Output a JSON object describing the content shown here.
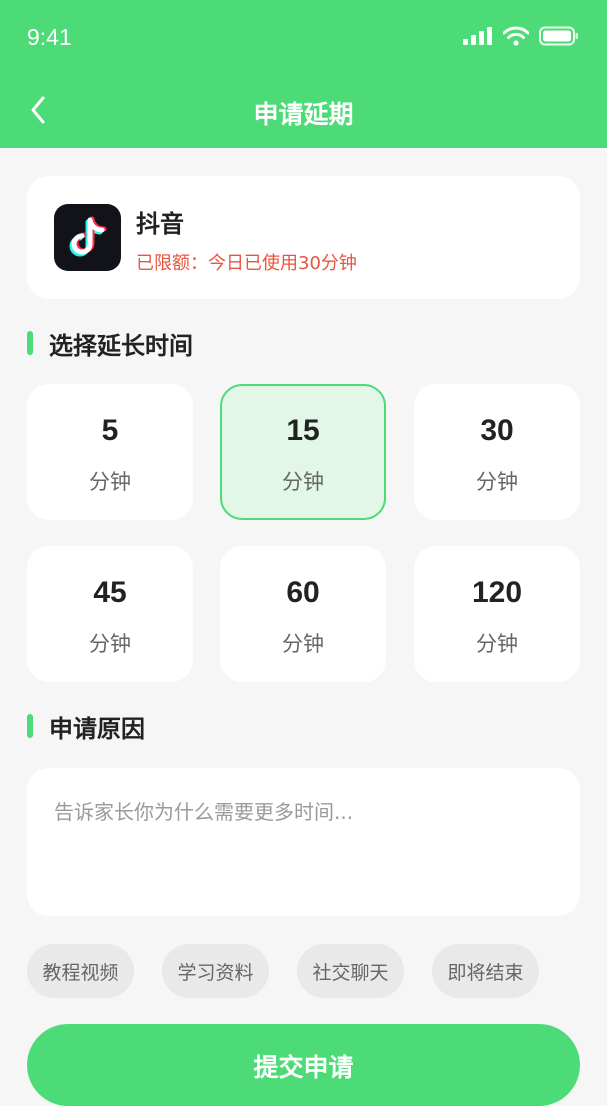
{
  "status_bar": {
    "time": "9:41"
  },
  "nav": {
    "title": "申请延期"
  },
  "app": {
    "name": "抖音",
    "status_text": "已限额：今日已使用30分钟"
  },
  "extend_section": {
    "title": "选择延长时间"
  },
  "options": [
    {
      "value": "5",
      "unit": "分钟",
      "selected": false
    },
    {
      "value": "15",
      "unit": "分钟",
      "selected": true
    },
    {
      "value": "30",
      "unit": "分钟",
      "selected": false
    },
    {
      "value": "45",
      "unit": "分钟",
      "selected": false
    },
    {
      "value": "60",
      "unit": "分钟",
      "selected": false
    },
    {
      "value": "120",
      "unit": "分钟",
      "selected": false
    }
  ],
  "reason_section": {
    "title": "申请原因"
  },
  "reason": {
    "placeholder": "告诉家长你为什么需要更多时间...",
    "value": ""
  },
  "quick_reasons": [
    "教程视频",
    "学习资料",
    "社交聊天",
    "即将结束"
  ],
  "submit": {
    "label": "提交申请"
  },
  "colors": {
    "brand_green": "#4cdb77",
    "selected_bg": "#e2f7e7",
    "warning_red": "#e8553e",
    "page_bg": "#f6f6f6"
  },
  "icons": {
    "back": "chevron-left-icon",
    "signal": "cellular-signal-icon",
    "wifi": "wifi-icon",
    "battery": "battery-icon",
    "app": "douyin-app-icon"
  }
}
